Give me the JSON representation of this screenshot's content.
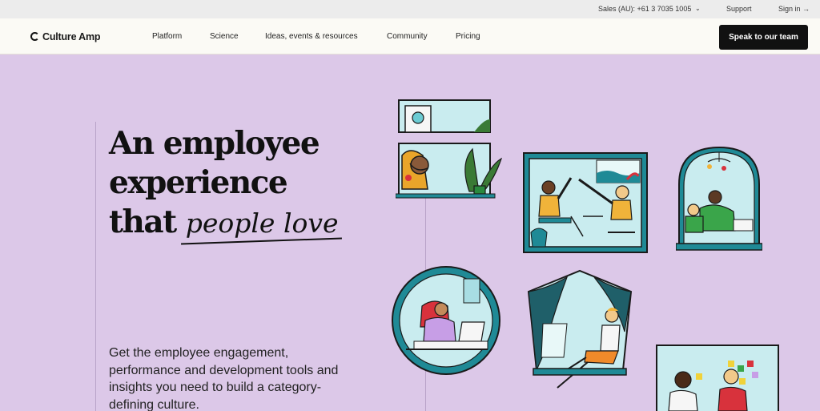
{
  "utility": {
    "sales": "Sales (AU): +61 3 7035 1005",
    "support": "Support",
    "signin": "Sign in →"
  },
  "nav": {
    "logo": "Culture Amp",
    "items": [
      "Platform",
      "Science",
      "Ideas, events & resources",
      "Community",
      "Pricing"
    ],
    "cta": "Speak to our team"
  },
  "hero": {
    "line1": "An employee",
    "line2": "experience",
    "line3_a": "that",
    "line3_b": "people love",
    "subtext": "Get the employee engagement, performance and development tools and insights you need to build a category-defining culture."
  },
  "colors": {
    "background": "#dcc8e8",
    "teal": "#1f8a96",
    "ink": "#1a1a1a"
  },
  "icons": [
    "chevron-down-icon",
    "arrow-right-icon",
    "culture-amp-logo-icon"
  ]
}
